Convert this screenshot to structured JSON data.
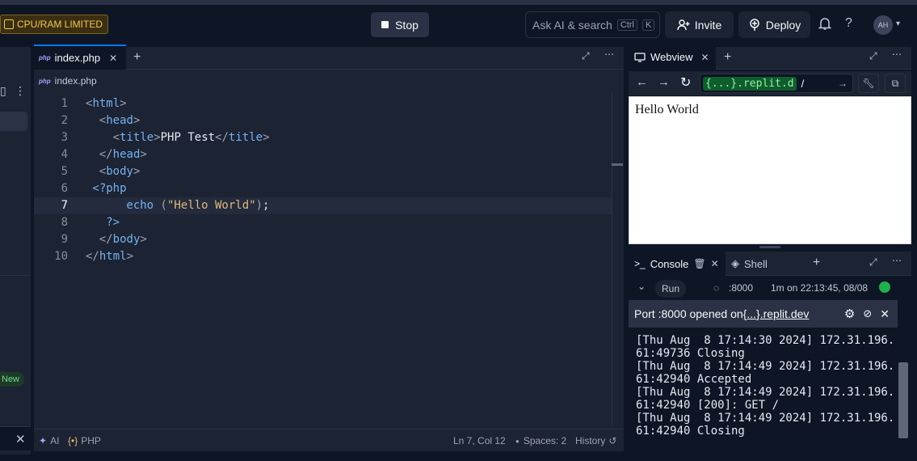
{
  "topbar": {
    "resource_badge": "CPU/RAM LIMITED",
    "stop_label": "Stop",
    "search_placeholder": "Ask AI & search",
    "search_kbd_1": "Ctrl",
    "search_kbd_2": "K",
    "invite_label": "Invite",
    "deploy_label": "Deploy",
    "avatar_initials": "AH",
    "help_glyph": "?"
  },
  "sidebar": {
    "new_badge": "New"
  },
  "editor": {
    "tab_label": "index.php",
    "breadcrumb": "index.php",
    "lines": [
      {
        "n": "1",
        "parts": [
          [
            "br",
            "<"
          ],
          [
            "tag",
            "html"
          ],
          [
            "br",
            ">"
          ]
        ],
        "indent": 0
      },
      {
        "n": "2",
        "parts": [
          [
            "br",
            "<"
          ],
          [
            "tag",
            "head"
          ],
          [
            "br",
            ">"
          ]
        ],
        "indent": 2
      },
      {
        "n": "3",
        "parts": [
          [
            "br",
            "<"
          ],
          [
            "tag",
            "title"
          ],
          [
            "br",
            ">"
          ],
          [
            "txt",
            "PHP Test"
          ],
          [
            "br",
            "</"
          ],
          [
            "tag",
            "title"
          ],
          [
            "br",
            ">"
          ]
        ],
        "indent": 4
      },
      {
        "n": "4",
        "parts": [
          [
            "br",
            "</"
          ],
          [
            "tag",
            "head"
          ],
          [
            "br",
            ">"
          ]
        ],
        "indent": 2
      },
      {
        "n": "5",
        "parts": [
          [
            "br",
            "<"
          ],
          [
            "tag",
            "body"
          ],
          [
            "br",
            ">"
          ]
        ],
        "indent": 2
      },
      {
        "n": "6",
        "parts": [
          [
            "tag",
            "<?php"
          ]
        ],
        "indent": 1
      },
      {
        "n": "7",
        "parts": [
          [
            "kw",
            "echo"
          ],
          [
            "txt",
            " "
          ],
          [
            "br",
            "("
          ],
          [
            "str",
            "\"Hello World\""
          ],
          [
            "br",
            ")"
          ],
          [
            "txt",
            ";"
          ]
        ],
        "indent": 6
      },
      {
        "n": "8",
        "parts": [
          [
            "tag",
            "?>"
          ]
        ],
        "indent": 3
      },
      {
        "n": "9",
        "parts": [
          [
            "br",
            "</"
          ],
          [
            "tag",
            "body"
          ],
          [
            "br",
            ">"
          ]
        ],
        "indent": 2
      },
      {
        "n": "10",
        "parts": [
          [
            "br",
            "</"
          ],
          [
            "tag",
            "html"
          ],
          [
            "br",
            ">"
          ]
        ],
        "indent": 0
      }
    ],
    "current_line": "7",
    "status": {
      "ai_label": "AI",
      "lang_label": "PHP",
      "position": "Ln 7, Col 12",
      "spaces": "Spaces: 2",
      "history": "History"
    }
  },
  "webview": {
    "tab_label": "Webview",
    "url_host": "{...}.replit.d",
    "url_path": "/",
    "content_text": "Hello World"
  },
  "console": {
    "tab_label": "Console",
    "shell_label": "Shell",
    "run_label": "Run",
    "port": ":8000",
    "uptime": "1m on 22:13:45, 08/08",
    "banner_text": "Port :8000 opened on ",
    "banner_link": "{...}.replit.dev",
    "output": "[Thu Aug  8 17:14:30 2024] 172.31.196.\n61:49736 Closing\n[Thu Aug  8 17:14:49 2024] 172.31.196.\n61:42940 Accepted\n[Thu Aug  8 17:14:49 2024] 172.31.196.\n61:42940 [200]: GET /\n[Thu Aug  8 17:14:49 2024] 172.31.196.\n61:42940 Closing"
  },
  "colors": {
    "accent": "#0079f2",
    "success": "#1fb14b",
    "warning": "#f0c64b"
  }
}
